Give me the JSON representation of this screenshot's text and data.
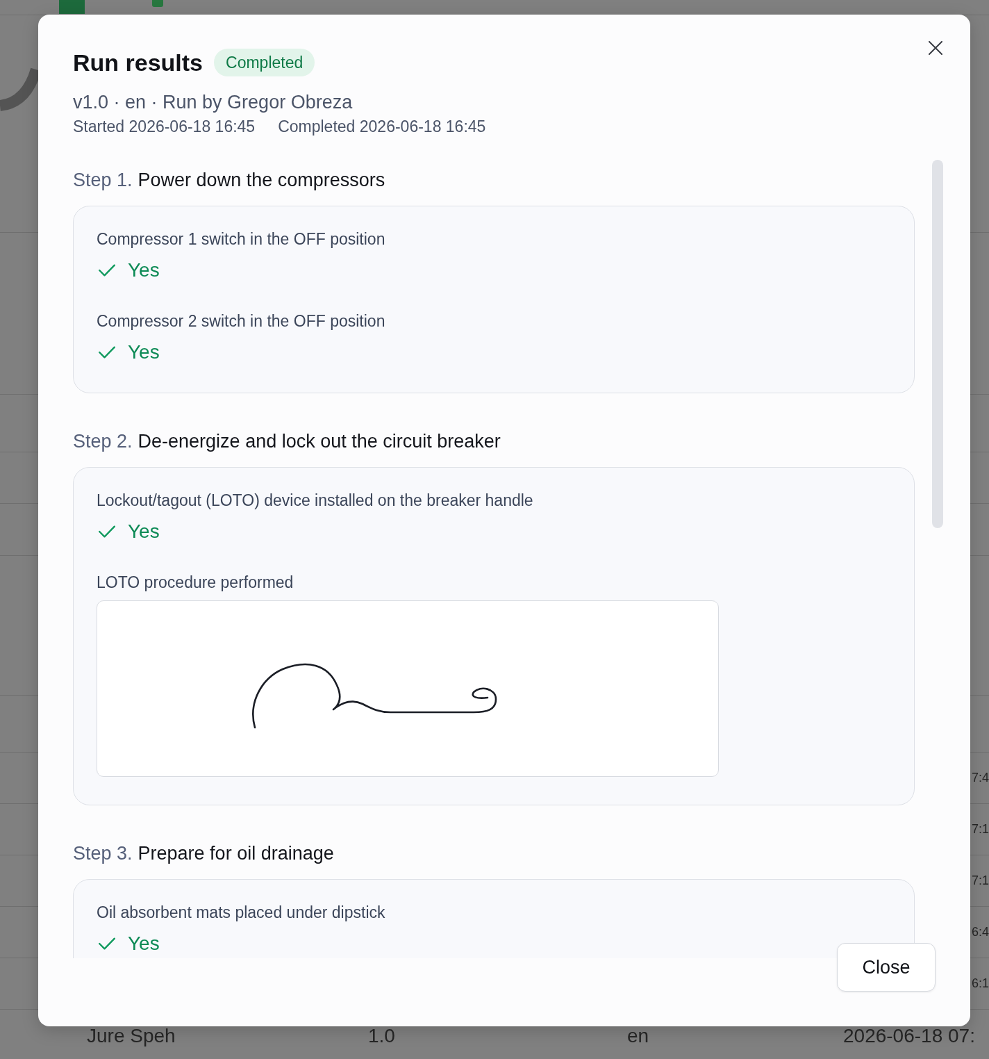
{
  "background": {
    "partial_cells": [
      "7:4",
      "7:1",
      "7:1",
      "6:4",
      "6:1"
    ],
    "bottom_row": [
      "Jure Speh",
      "1.0",
      "en",
      "2026-06-18 07:"
    ]
  },
  "dialog": {
    "title": "Run results",
    "status": {
      "label": "Completed",
      "kind": "success"
    },
    "meta": "v1.0 · en · Run by Gregor Obreza",
    "started": "Started 2026-06-18 16:45",
    "completed": "Completed 2026-06-18 16:45",
    "steps": [
      {
        "number": "Step 1.",
        "title": "Power down the compressors",
        "items": [
          {
            "kind": "check",
            "label": "Compressor 1 switch in the OFF position",
            "answer": "Yes",
            "passed": true
          },
          {
            "kind": "check",
            "label": "Compressor 2 switch in the OFF position",
            "answer": "Yes",
            "passed": true
          }
        ]
      },
      {
        "number": "Step 2.",
        "title": "De-energize and lock out the circuit breaker",
        "items": [
          {
            "kind": "check",
            "label": "Lockout/tagout (LOTO) device installed on the breaker handle",
            "answer": "Yes",
            "passed": true
          },
          {
            "kind": "signature",
            "label": "LOTO procedure performed"
          }
        ]
      },
      {
        "number": "Step 3.",
        "title": "Prepare for oil drainage",
        "items": [
          {
            "kind": "check",
            "label": "Oil absorbent mats placed under dipstick",
            "answer": "Yes",
            "passed": true
          }
        ]
      }
    ],
    "close_button": "Close"
  }
}
